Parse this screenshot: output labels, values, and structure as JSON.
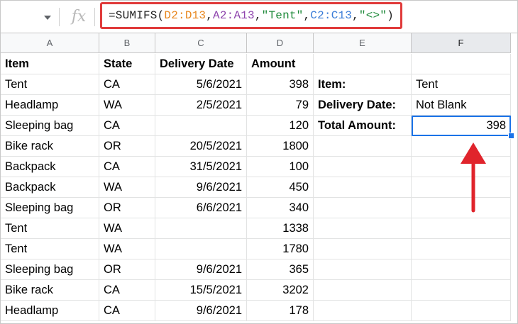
{
  "formula_bar": {
    "fx_label": "fx",
    "formula_parts": [
      {
        "text": "=SUMIFS(",
        "color": "default"
      },
      {
        "text": "D2:D13",
        "color": "orange"
      },
      {
        "text": ",",
        "color": "default"
      },
      {
        "text": "A2:A13",
        "color": "purple"
      },
      {
        "text": ",",
        "color": "default"
      },
      {
        "text": "\"Tent\"",
        "color": "green"
      },
      {
        "text": ",",
        "color": "default"
      },
      {
        "text": "C2:C13",
        "color": "blue"
      },
      {
        "text": ",",
        "color": "default"
      },
      {
        "text": "\"<>\"",
        "color": "green"
      },
      {
        "text": ")",
        "color": "default"
      }
    ]
  },
  "columns": [
    "A",
    "B",
    "C",
    "D",
    "E",
    "F"
  ],
  "selected_column": "F",
  "headers": [
    "Item",
    "State",
    "Delivery Date",
    "Amount"
  ],
  "rows": [
    [
      "Tent",
      "CA",
      "5/6/2021",
      "398"
    ],
    [
      "Headlamp",
      "WA",
      "2/5/2021",
      "79"
    ],
    [
      "Sleeping bag",
      "CA",
      "",
      "120"
    ],
    [
      "Bike rack",
      "OR",
      "20/5/2021",
      "1800"
    ],
    [
      "Backpack",
      "CA",
      "31/5/2021",
      "100"
    ],
    [
      "Backpack",
      "WA",
      "9/6/2021",
      "450"
    ],
    [
      "Sleeping bag",
      "OR",
      "6/6/2021",
      "340"
    ],
    [
      "Tent",
      "WA",
      "",
      "1338"
    ],
    [
      "Tent",
      "WA",
      "",
      "1780"
    ],
    [
      "Sleeping bag",
      "OR",
      "9/6/2021",
      "365"
    ],
    [
      "Bike rack",
      "CA",
      "15/5/2021",
      "3202"
    ],
    [
      "Headlamp",
      "CA",
      "9/6/2021",
      "178"
    ]
  ],
  "criteria": [
    {
      "label": "Item:",
      "value": "Tent"
    },
    {
      "label": "Delivery Date:",
      "value": "Not Blank"
    },
    {
      "label": "Total Amount:",
      "value": "398"
    }
  ],
  "colors": {
    "highlight_box": "#e03b3b",
    "selection": "#1a73e8",
    "arrow": "#e0242c"
  }
}
